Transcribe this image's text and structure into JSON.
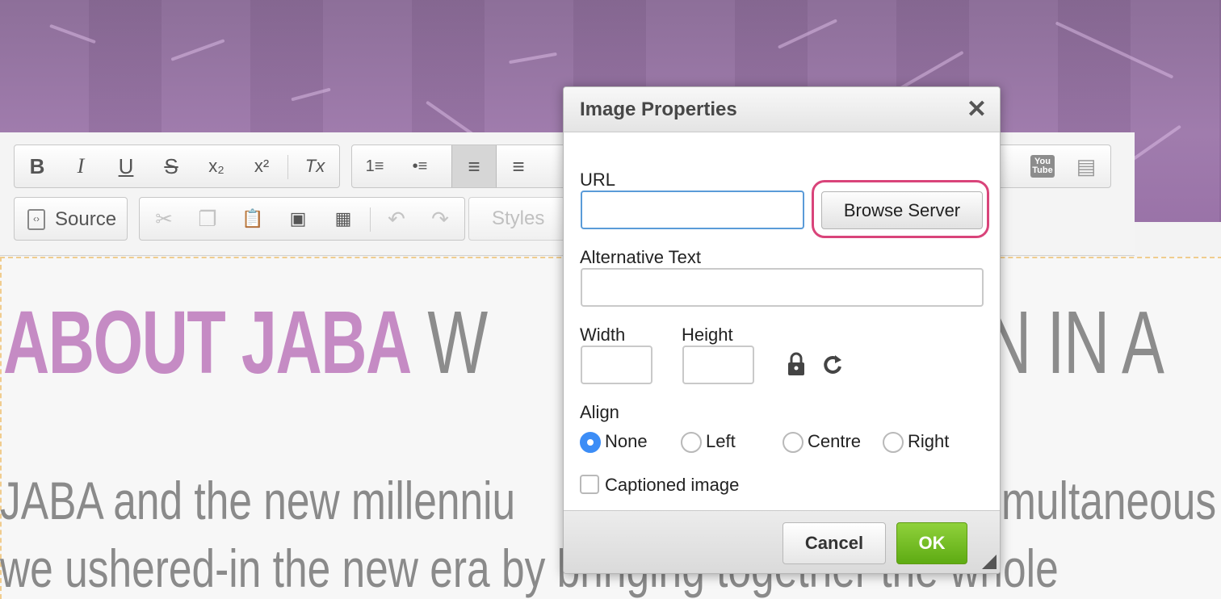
{
  "page": {
    "headline_strong": "ABOUT JABA",
    "headline_light_left": "W",
    "headline_light_right": "GN IN A",
    "body_line1_left": "JABA and the new millenniu",
    "body_line1_right": "multaneous",
    "body_line2": "we ushered-in the new era by bringing together the whole"
  },
  "toolbar": {
    "row1": [
      {
        "name": "bold-button",
        "glyph": "B"
      },
      {
        "name": "italic-button",
        "glyph": "I"
      },
      {
        "name": "underline-button",
        "glyph": "U"
      },
      {
        "name": "strikethrough-button",
        "glyph": "S"
      },
      {
        "name": "subscript-button",
        "glyph": "x₂"
      },
      {
        "name": "superscript-button",
        "glyph": "x²"
      },
      {
        "name": "remove-format-button",
        "glyph": "Tx"
      },
      {
        "name": "numbered-list-button",
        "glyph": "1≡"
      },
      {
        "name": "bulleted-list-button",
        "glyph": "•≡"
      },
      {
        "name": "align-left-button",
        "glyph": "≡"
      },
      {
        "name": "align-center-button",
        "glyph": "≡"
      },
      {
        "name": "youtube-button",
        "glyph": "You Tube"
      },
      {
        "name": "insert-template-button",
        "glyph": "▤"
      }
    ],
    "source_label": "Source",
    "styles_placeholder": "Styles"
  },
  "dialog": {
    "title": "Image Properties",
    "close_glyph": "✕",
    "url_label": "URL",
    "url_value": "",
    "browse_label": "Browse Server",
    "alt_label": "Alternative Text",
    "alt_value": "",
    "width_label": "Width",
    "width_value": "",
    "height_label": "Height",
    "height_value": "",
    "align_label": "Align",
    "align_options": [
      "None",
      "Left",
      "Centre",
      "Right"
    ],
    "align_selected": "None",
    "captioned_label": "Captioned image",
    "captioned_checked": false,
    "cancel_label": "Cancel",
    "ok_label": "OK"
  },
  "colors": {
    "accent_ok": "#6bb81e",
    "highlight_ring": "#d9447a",
    "radio_selected": "#3c8df6",
    "headline_purple": "#c58bc4"
  }
}
